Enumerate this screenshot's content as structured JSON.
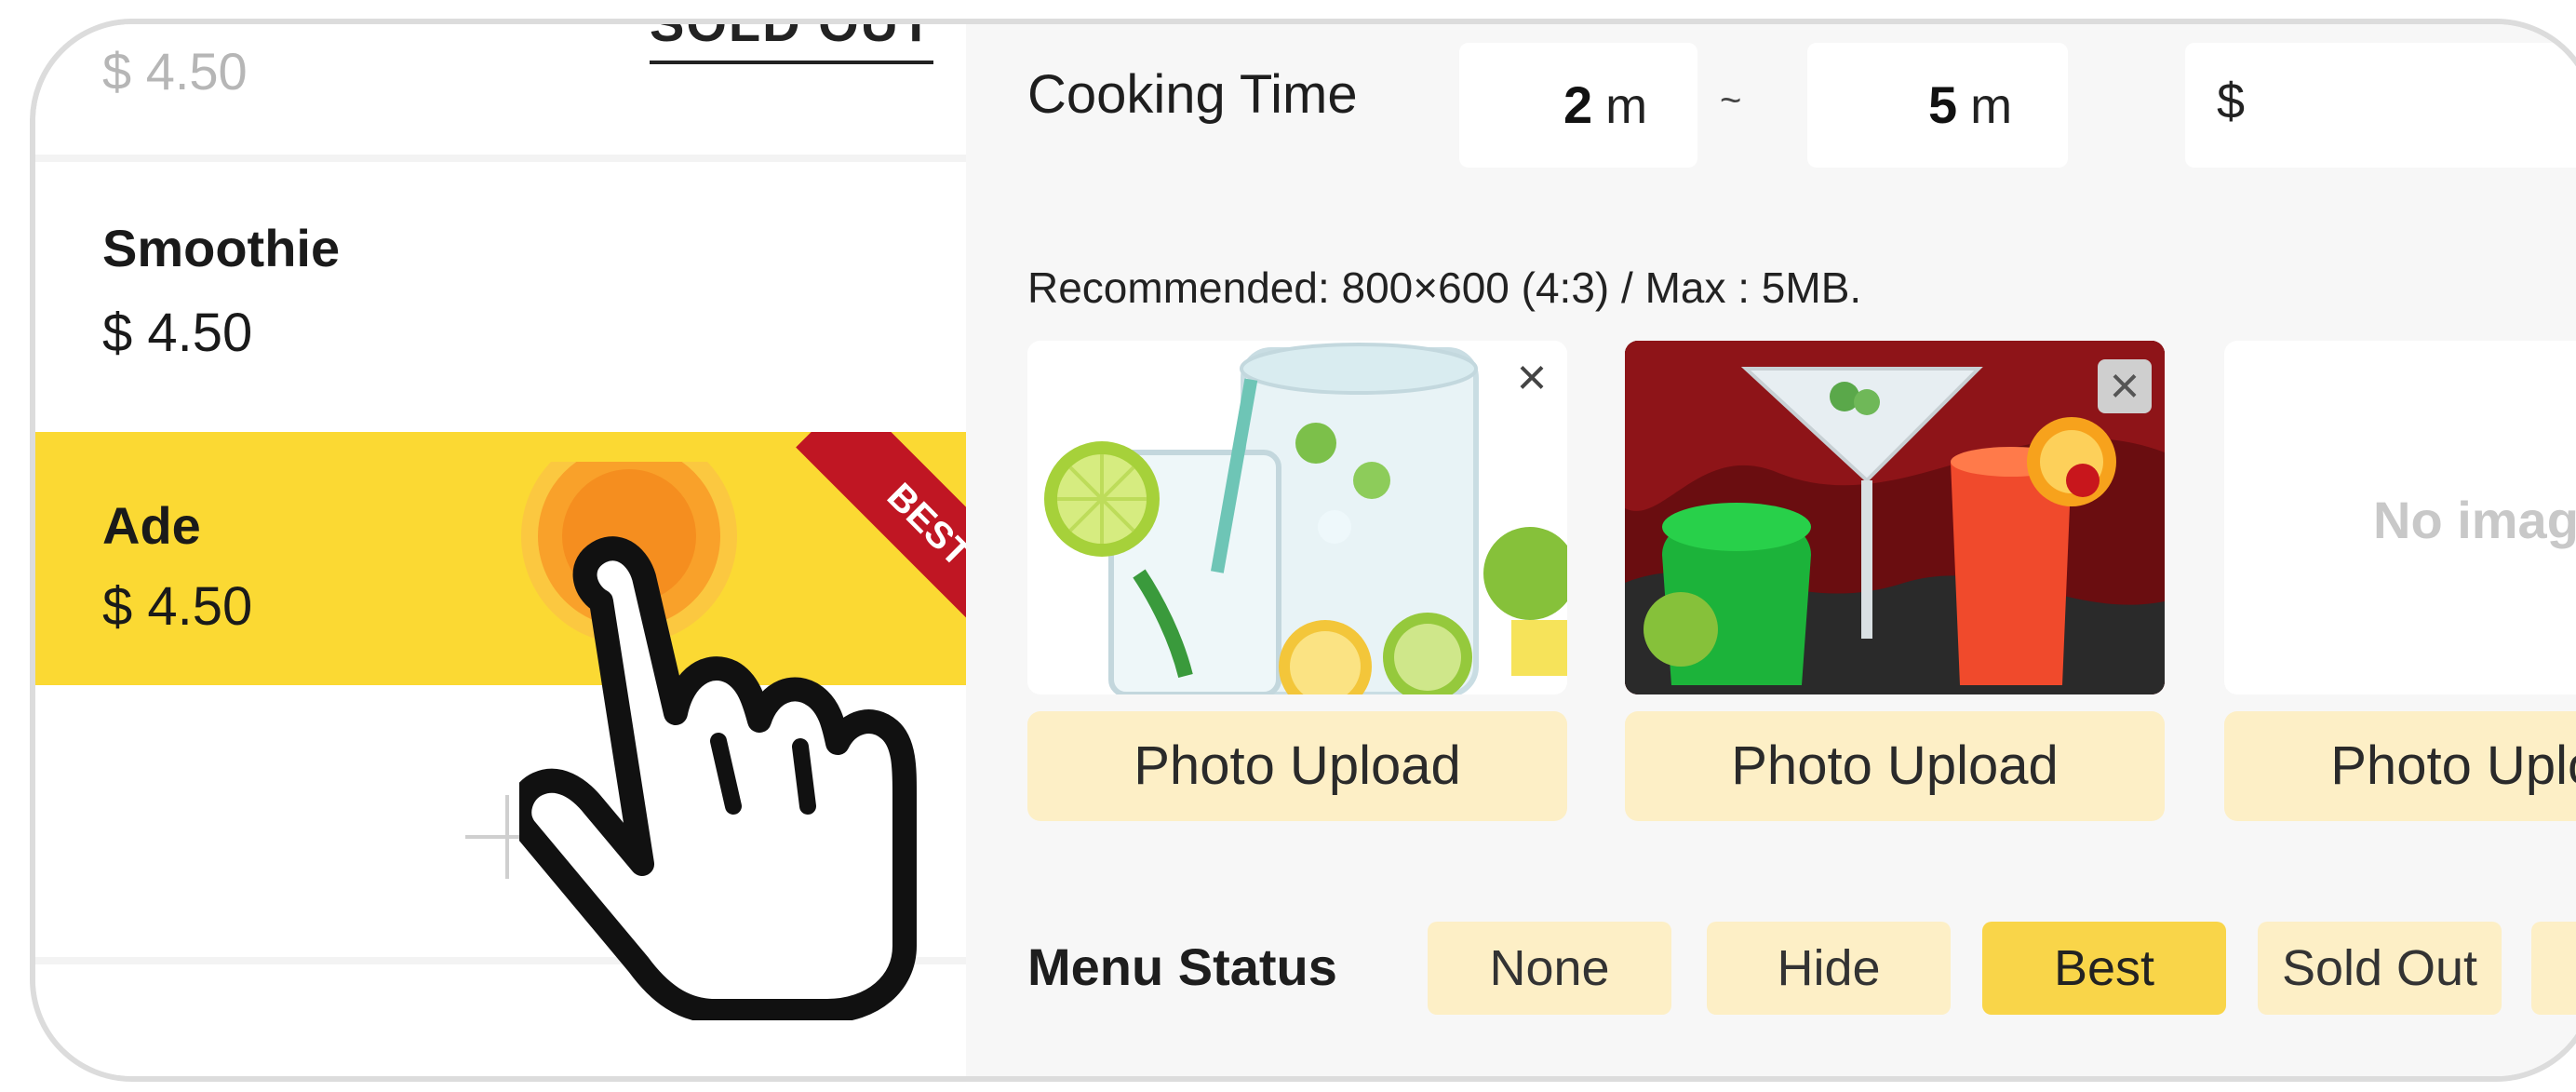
{
  "menu": {
    "top_item": {
      "price": "$ 4.50",
      "badge": "SOLD OUT"
    },
    "items": [
      {
        "name": "Smoothie",
        "price": "$ 4.50"
      },
      {
        "name": "Ade",
        "price": "$ 4.50",
        "ribbon": "BEST"
      }
    ],
    "add_icon": "plus-icon"
  },
  "form": {
    "cooking_time_label": "Cooking Time",
    "min_time": "2",
    "max_time": "5",
    "unit": "m",
    "separator": "~",
    "price_symbol": "$",
    "recommendation": "Recommended: 800×600 (4:3) / Max : 5MB.",
    "photos": [
      {
        "upload_label": "Photo Upload",
        "has_image": true
      },
      {
        "upload_label": "Photo Upload",
        "has_image": true
      },
      {
        "upload_label": "Photo Upload",
        "has_image": false,
        "placeholder": "No image"
      }
    ],
    "menu_status_label": "Menu Status",
    "status_options": [
      "None",
      "Hide",
      "Best",
      "Sold Out"
    ],
    "selected_status": "Best"
  },
  "colors": {
    "highlight": "#fbd933",
    "ribbon": "#c01623",
    "chip": "#fdefc6",
    "chip_active": "#f9d549"
  }
}
